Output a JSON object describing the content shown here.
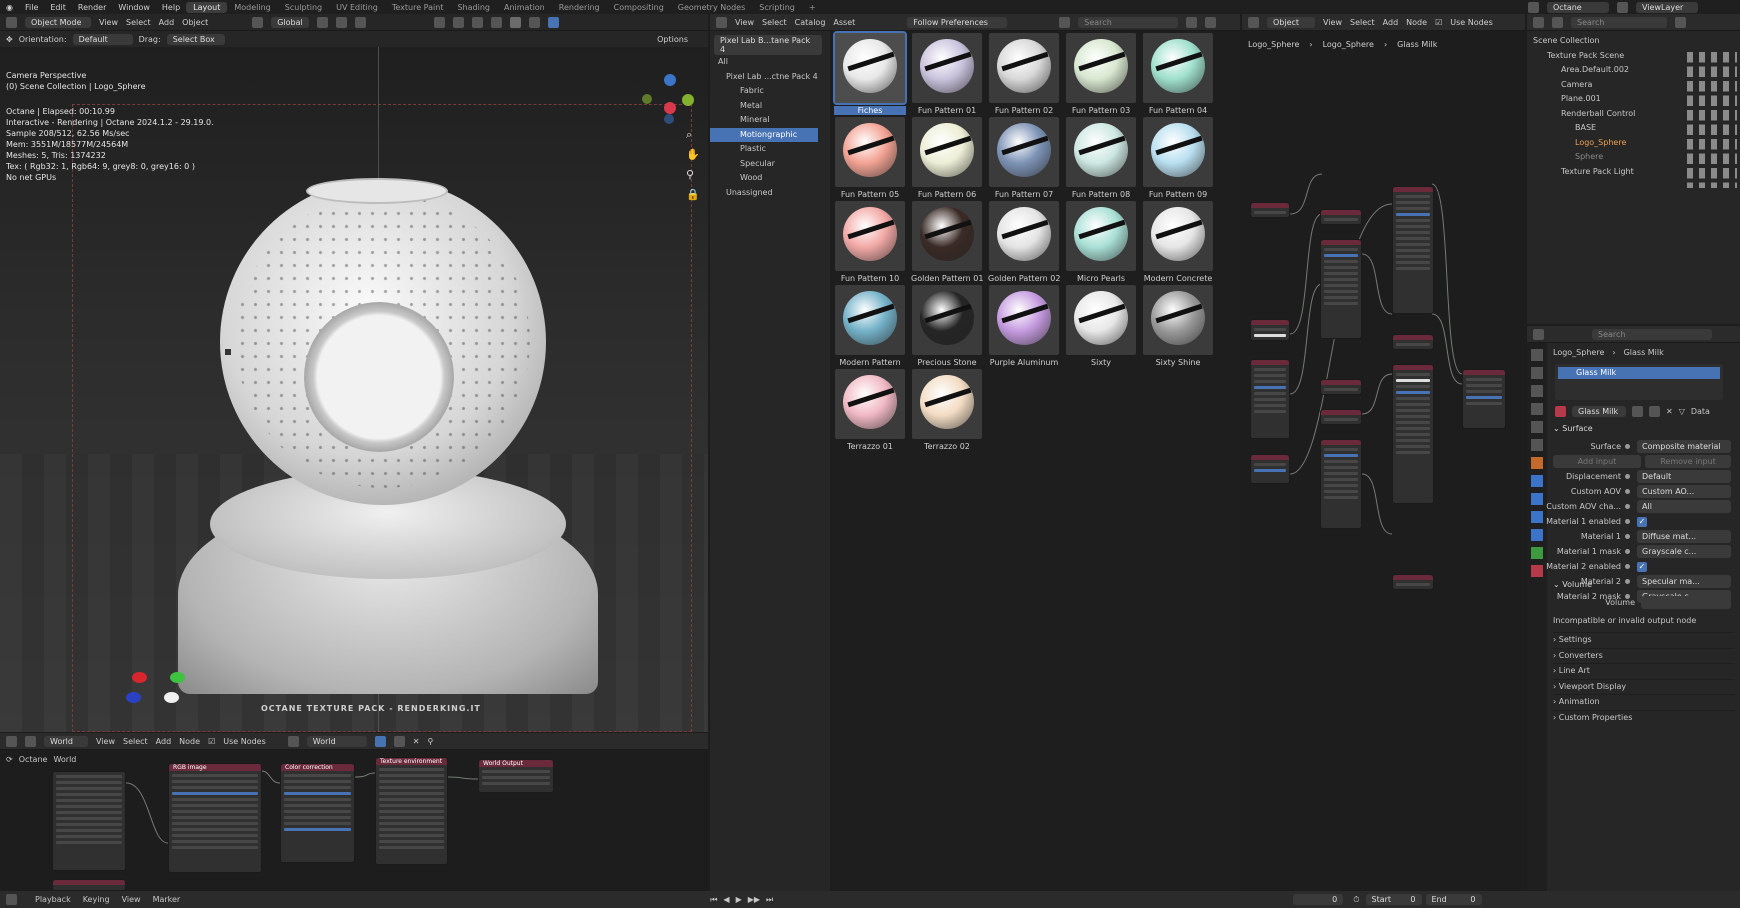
{
  "app_menu": [
    "File",
    "Edit",
    "Render",
    "Window",
    "Help"
  ],
  "workspaces": [
    "Layout",
    "Modeling",
    "Sculpting",
    "UV Editing",
    "Texture Paint",
    "Shading",
    "Animation",
    "Rendering",
    "Compositing",
    "Geometry Nodes",
    "Scripting"
  ],
  "top_right": {
    "engine": "Octane",
    "view_layer": "ViewLayer"
  },
  "viewport": {
    "mode": "Object Mode",
    "menus": [
      "View",
      "Select",
      "Add",
      "Object"
    ],
    "orientation_label": "Orientation:",
    "orientation": "Default",
    "drag_label": "Drag:",
    "drag": "Select Box",
    "transform": "Global",
    "options": "Options",
    "info_lines": [
      "Camera Perspective",
      "(0) Scene Collection | Logo_Sphere"
    ],
    "render_lines": [
      "Octane | Elapsed: 00:10.99",
      "Interactive - Rendering | Octane 2024.1.2 - 29.19.0.",
      "Sample 208/512, 62.56 Ms/sec",
      "",
      "Mem: 3551M/18577M/24564M",
      "Meshes: 5, Tris: 1374232",
      "Tex: ( Rgb32: 1, Rgb64: 9, grey8: 0, grey16: 0 )",
      "",
      "No net GPUs"
    ],
    "watermark": "OCTANE TEXTURE PACK - RENDERKING.IT"
  },
  "asset_browser": {
    "menus": [
      "View",
      "Select",
      "Catalog",
      "Asset"
    ],
    "library": "Pixel Lab B...tane Pack 4",
    "import": "Follow Preferences",
    "search_placeholder": "Search",
    "catalog_root": "All",
    "catalog_pack": "Pixel Lab ...ctne Pack 4",
    "catalogs": [
      "Fabric",
      "Metal",
      "Mineral",
      "Motiongraphic",
      "Plastic",
      "Specular",
      "Wood"
    ],
    "unassigned": "Unassigned",
    "assets": [
      {
        "name": "Fiches",
        "color": "#e8e8e8"
      },
      {
        "name": "Fun Pattern 01",
        "color": "#c9c3dd"
      },
      {
        "name": "Fun Pattern 02",
        "color": "#d8d8d8"
      },
      {
        "name": "Fun Pattern 03",
        "color": "#d8e8d0"
      },
      {
        "name": "Fun Pattern 04",
        "color": "#9fe0cd"
      },
      {
        "name": "Fun Pattern 05",
        "color": "#f3a394"
      },
      {
        "name": "Fun Pattern 06",
        "color": "#ecefd6"
      },
      {
        "name": "Fun Pattern 07",
        "color": "#7d93b5"
      },
      {
        "name": "Fun Pattern 08",
        "color": "#cde8e2"
      },
      {
        "name": "Fun Pattern 09",
        "color": "#b9dff0"
      },
      {
        "name": "Fun Pattern 10",
        "color": "#f2a9a6"
      },
      {
        "name": "Golden Pattern 01",
        "color": "#3a2a25"
      },
      {
        "name": "Golden Pattern 02",
        "color": "#e4e4e4"
      },
      {
        "name": "Micro Pearls",
        "color": "#a9e0d6"
      },
      {
        "name": "Modern Concrete",
        "color": "#e6e6e6"
      },
      {
        "name": "Modern Pattern",
        "color": "#74b2c9"
      },
      {
        "name": "Precious Stone",
        "color": "#252525"
      },
      {
        "name": "Purple Aluminum",
        "color": "#c59be0"
      },
      {
        "name": "Sixty",
        "color": "#e8e8e8"
      },
      {
        "name": "Sixty Shine",
        "color": "#9a9a9a"
      },
      {
        "name": "Terrazzo 01",
        "color": "#f1b9c4"
      },
      {
        "name": "Terrazzo 02",
        "color": "#f3dcc4"
      }
    ]
  },
  "node_editor": {
    "object": "Object",
    "menus": [
      "View",
      "Select",
      "Add",
      "Node"
    ],
    "use_nodes": "Use Nodes",
    "breadcrumbs": [
      "Logo_Sphere",
      "Logo_Sphere",
      "Glass Milk"
    ]
  },
  "outliner": {
    "search_placeholder": "Search",
    "root": "Scene Collection",
    "items": [
      "Texture Pack Scene",
      "Area.Default.002",
      "Camera",
      "Plane.001",
      "Renderball Control",
      "BASE",
      "Logo_Sphere",
      "Sphere",
      "Texture Pack Light"
    ]
  },
  "properties": {
    "search_placeholder": "Search",
    "breadcrumb": [
      "Logo_Sphere",
      "Glass Milk"
    ],
    "slot": "Glass Milk",
    "material": "Glass Milk",
    "data": "Data",
    "surface_section": "Surface",
    "rows": [
      {
        "label": "Surface",
        "value": "Composite material"
      },
      {
        "label": "Displacement",
        "value": "Default"
      },
      {
        "label": "Custom AOV",
        "value": "Custom AO..."
      },
      {
        "label": "Custom AOV cha...",
        "value": "All"
      },
      {
        "label": "Material 1 enabled",
        "value": ""
      },
      {
        "label": "Material 1",
        "value": "Diffuse mat..."
      },
      {
        "label": "Material 1 mask",
        "value": "Grayscale c..."
      },
      {
        "label": "Material 2 enabled",
        "value": ""
      },
      {
        "label": "Material 2",
        "value": "Specular ma..."
      },
      {
        "label": "Material 2 mask",
        "value": "Grayscale c..."
      }
    ],
    "add_input": "Add input",
    "remove_input": "Remove input",
    "volume_section": "Volume",
    "volume_label": "Volume",
    "volume_warning": "Incompatible or invalid output node",
    "sections": [
      "Settings",
      "Converters",
      "Line Art",
      "Viewport Display",
      "Animation",
      "Custom Properties"
    ]
  },
  "world_editor": {
    "world": "World",
    "menus": [
      "View",
      "Select",
      "Add",
      "Node"
    ],
    "use_nodes": "Use Nodes",
    "world2": "World",
    "tree_label": "Octane",
    "tree_world": "World",
    "nodes": [
      "RGB image",
      "Color correction",
      "Texture environment",
      "World Output"
    ]
  },
  "timeline": {
    "menus": [
      "Playback",
      "Keying",
      "View",
      "Marker"
    ],
    "frame": "0",
    "start_label": "Start",
    "start": "0",
    "end_label": "End",
    "end": "0"
  }
}
